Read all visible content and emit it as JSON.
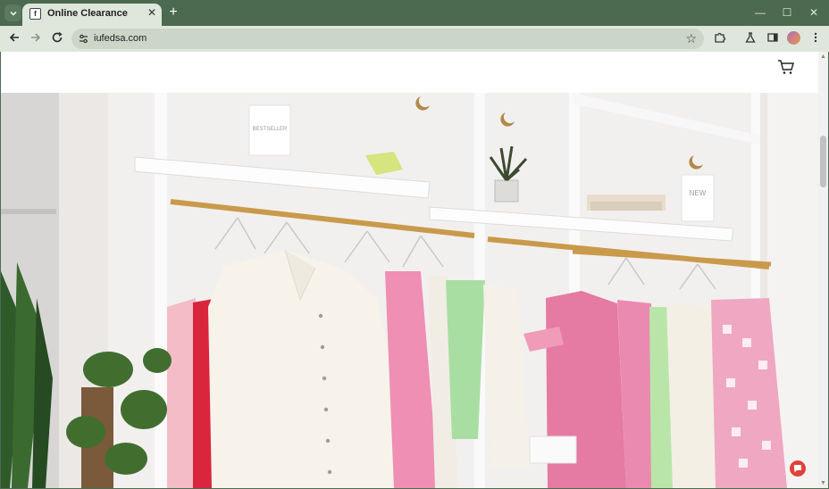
{
  "browser": {
    "tab_title": "Online Clearance",
    "favicon_text": "f",
    "url": "iufedsa.com",
    "accent": "#4b6a50",
    "chrome_light": "#dfe7dc"
  },
  "icons": {
    "tab_search": "chevron-down-icon",
    "close_tab": "close-icon",
    "new_tab": "plus-icon",
    "minimize": "minimize-icon",
    "maximize": "maximize-icon",
    "close_window": "close-icon",
    "back": "arrow-left-icon",
    "forward": "arrow-right-icon",
    "reload": "reload-icon",
    "site_info": "tune-icon",
    "bookmark": "star-icon",
    "extensions": "puzzle-icon",
    "labs": "flask-icon",
    "side_panel": "side-panel-icon",
    "menu": "kebab-menu-icon",
    "cart": "cart-icon",
    "chat": "chat-icon"
  },
  "hero": {
    "shelf_label_1": "BESTSELLER",
    "shelf_label_2": "NEW"
  }
}
